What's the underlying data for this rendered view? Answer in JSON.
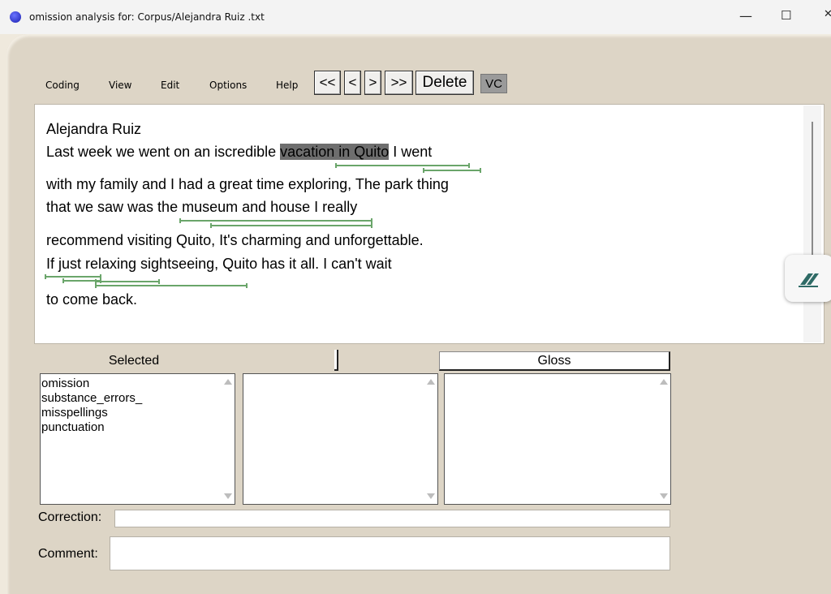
{
  "window": {
    "title": "omission analysis for: Corpus/Alejandra Ruiz .txt",
    "minimize_glyph": "—",
    "maximize_glyph": "☐",
    "close_glyph": "✕"
  },
  "menu": {
    "coding": "Coding",
    "view": "View",
    "edit": "Edit",
    "options": "Options",
    "help": "Help"
  },
  "toolbar": {
    "first": "<<",
    "prev": "<",
    "next": ">",
    "last": ">>",
    "delete": "Delete",
    "vc": "VC"
  },
  "document": {
    "author": "Alejandra Ruiz",
    "line1_pre": "Last week we went on an iscredible ",
    "line1_highlight": "vacation in Quito",
    "line1_post": " I went",
    "line2": "with my family and I had a great time exploring, The park thing",
    "line3": "that we saw was the museum and house I really",
    "line4": "recommend visiting Quito, It's charming and unforgettable.",
    "line5": "If just relaxing sightseeing, Quito has it all. I can't wait",
    "line6": "to come back."
  },
  "panels": {
    "selected_header": "Selected",
    "gloss_header": "Gloss",
    "selected_items": [
      "omission",
      "substance_errors_",
      "misspellings",
      "punctuation"
    ]
  },
  "fields": {
    "correction_label": "Correction:",
    "correction_value": "",
    "comment_label": "Comment:",
    "comment_value": ""
  },
  "colors": {
    "highlight": "#6e6e6e",
    "underline": "#6aa56a",
    "frame": "#ddd5c6"
  }
}
